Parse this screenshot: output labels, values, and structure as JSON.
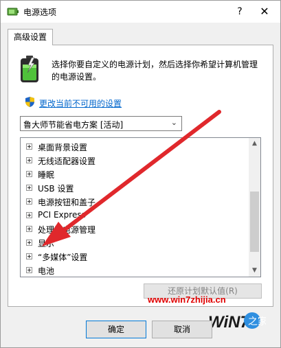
{
  "window": {
    "title": "电源选项",
    "help_label": "?",
    "close_label": "✕"
  },
  "tabs": [
    {
      "label": "高级设置"
    }
  ],
  "description": "选择你要自定义的电源计划，然后选择你希望计算机管理的电源设置。",
  "change_link": "更改当前不可用的设置",
  "plan_select": {
    "value": "鲁大师节能省电方案 [活动]",
    "arrow": "⌄"
  },
  "tree_items": [
    {
      "label": "桌面背景设置"
    },
    {
      "label": "无线适配器设置"
    },
    {
      "label": "睡眠"
    },
    {
      "label": "USB 设置"
    },
    {
      "label": "电源按钮和盖子"
    },
    {
      "label": "PCI Express"
    },
    {
      "label": "处理器电源管理"
    },
    {
      "label": "显示"
    },
    {
      "label": "“多媒体”设置"
    },
    {
      "label": "电池"
    }
  ],
  "scrollbar": {
    "up": "▲",
    "down": "▼"
  },
  "restore_button": "还原计划默认值(R)",
  "ok_button": "确定",
  "cancel_button": "取消",
  "watermark": {
    "url": "www.win7zhijia.cn",
    "logo_text": "WiN7.",
    "logo_suffix": "之家"
  },
  "colors": {
    "link": "#0066cc",
    "arrow": "#e0282c",
    "watermark": "#e00000"
  }
}
